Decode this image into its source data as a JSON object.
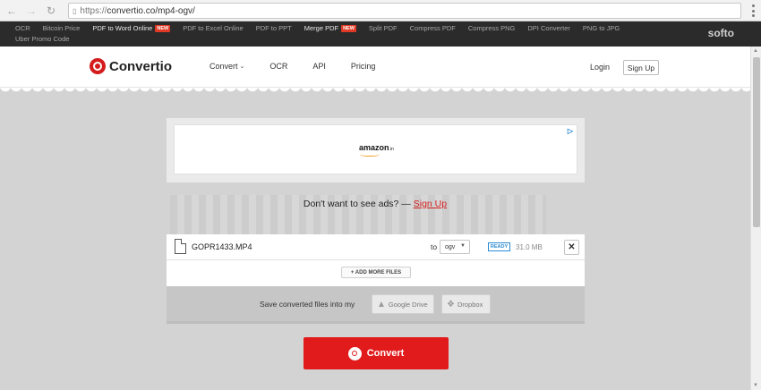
{
  "browser": {
    "url_scheme": "https://",
    "url_rest": "convertio.co/mp4-ogv/"
  },
  "softo_bar": {
    "links": [
      {
        "label": "OCR",
        "highlight": false,
        "badge": ""
      },
      {
        "label": "Bitcoin Price",
        "highlight": false,
        "badge": ""
      },
      {
        "label": "PDF to Word Online",
        "highlight": true,
        "badge": "NEW"
      },
      {
        "label": "PDF to Excel Online",
        "highlight": false,
        "badge": ""
      },
      {
        "label": "PDF to PPT",
        "highlight": false,
        "badge": ""
      },
      {
        "label": "Merge PDF",
        "highlight": true,
        "badge": "NEW"
      },
      {
        "label": "Split PDF",
        "highlight": false,
        "badge": ""
      },
      {
        "label": "Compress PDF",
        "highlight": false,
        "badge": ""
      },
      {
        "label": "Compress PNG",
        "highlight": false,
        "badge": ""
      },
      {
        "label": "DPI Converter",
        "highlight": false,
        "badge": ""
      },
      {
        "label": "PNG to JPG",
        "highlight": false,
        "badge": ""
      },
      {
        "label": "Uber Promo Code",
        "highlight": false,
        "badge": ""
      }
    ],
    "brand": "softo"
  },
  "header": {
    "logo_text": "Convertio",
    "nav": {
      "convert": "Convert",
      "ocr": "OCR",
      "api": "API",
      "pricing": "Pricing"
    },
    "login": "Login",
    "signup": "Sign Up"
  },
  "ad": {
    "brand": "amazon",
    "brand_suffix": ".in",
    "adchoices": "▷"
  },
  "noads": {
    "text": "Don't want to see ads? — ",
    "link": "Sign Up"
  },
  "file": {
    "name": "GOPR1433.MP4",
    "to_label": "to",
    "format": "ogv",
    "status": "READY",
    "size": "31.0 MB"
  },
  "actions": {
    "add_more": "+ ADD MORE FILES",
    "save_label": "Save converted files into my",
    "google_drive": "Google Drive",
    "dropbox": "Dropbox",
    "convert": "Convert"
  },
  "colors": {
    "brand_red": "#e11b1b",
    "ready_blue": "#2a8ad4"
  }
}
